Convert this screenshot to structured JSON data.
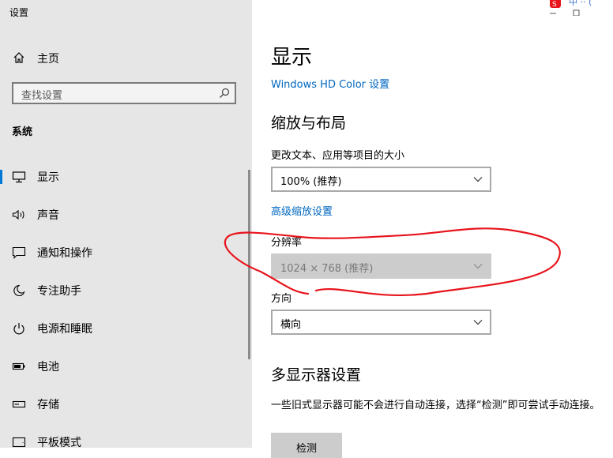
{
  "app": {
    "title": "设置"
  },
  "sidebar": {
    "home_label": "主页",
    "search_placeholder": "查找设置",
    "section": "系统",
    "items": [
      {
        "label": "显示",
        "icon": "monitor-icon",
        "selected": true
      },
      {
        "label": "声音",
        "icon": "speaker-icon"
      },
      {
        "label": "通知和操作",
        "icon": "notification-icon"
      },
      {
        "label": "专注助手",
        "icon": "moon-icon"
      },
      {
        "label": "电源和睡眠",
        "icon": "power-icon"
      },
      {
        "label": "电池",
        "icon": "battery-icon"
      },
      {
        "label": "存储",
        "icon": "storage-icon"
      },
      {
        "label": "平板模式",
        "icon": "tablet-icon"
      }
    ]
  },
  "main": {
    "title": "显示",
    "hd_color_link": "Windows HD Color 设置",
    "scale_layout": {
      "heading": "缩放与布局",
      "text_size_label": "更改文本、应用等项目的大小",
      "text_size_value": "100% (推荐)",
      "advanced_link": "高级缩放设置",
      "resolution_label": "分辨率",
      "resolution_value": "1024 × 768 (推荐)",
      "orientation_label": "方向",
      "orientation_value": "横向"
    },
    "multi_display": {
      "heading": "多显示器设置",
      "description": "一些旧式显示器可能不会进行自动连接，选择“检测”即可尝试手动连接。",
      "detect_button": "检测"
    }
  },
  "colors": {
    "accent": "#0078d7",
    "link": "#0067c0",
    "annotation": "#e8141c",
    "sidebar_bg": "#e6e6e6"
  }
}
